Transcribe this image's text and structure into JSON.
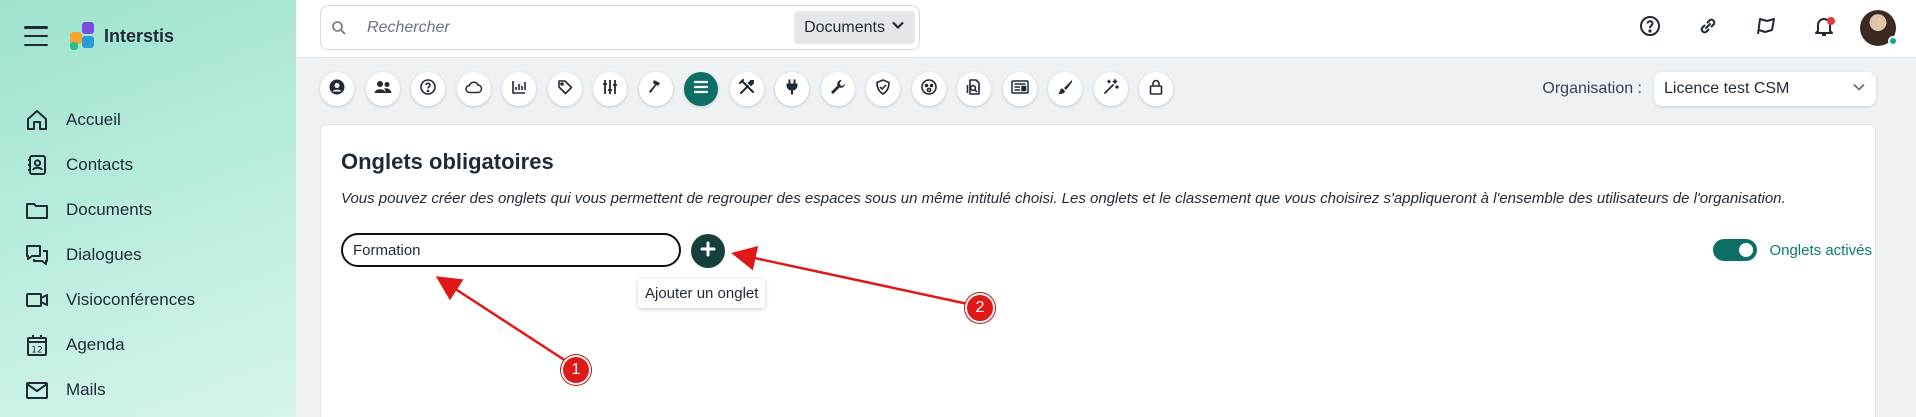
{
  "app": {
    "name": "Interstis"
  },
  "nav": {
    "items": [
      {
        "label": "Accueil",
        "icon": "home-icon"
      },
      {
        "label": "Contacts",
        "icon": "contacts-icon"
      },
      {
        "label": "Documents",
        "icon": "folder-icon"
      },
      {
        "label": "Dialogues",
        "icon": "chat-icon"
      },
      {
        "label": "Visioconférences",
        "icon": "video-icon"
      },
      {
        "label": "Agenda",
        "icon": "calendar-icon"
      },
      {
        "label": "Mails",
        "icon": "mail-icon"
      }
    ],
    "agenda_day": "12"
  },
  "search": {
    "placeholder": "Rechercher",
    "scope": "Documents"
  },
  "topbar": {
    "icons": [
      "help-icon",
      "link-icon",
      "flag-icon",
      "bell-icon",
      "avatar"
    ],
    "notif_color": "#e53935"
  },
  "toolbar": {
    "icons": [
      "user-icon",
      "users-icon",
      "help-icon",
      "cloud-icon",
      "chart-icon",
      "tag-icon",
      "sliders-icon",
      "hammer-icon",
      "list-icon",
      "tools-icon",
      "plug-icon",
      "wrench-icon",
      "shield-check-icon",
      "face-icon",
      "document-search-icon",
      "id-card-icon",
      "brush-icon",
      "magic-wand-icon",
      "lock-icon"
    ],
    "active_index": 8
  },
  "org": {
    "label": "Organisation :",
    "value": "Licence test CSM"
  },
  "card": {
    "title": "Onglets obligatoires",
    "description": "Vous pouvez créer des onglets qui vous permettent de regrouper des espaces sous un même intitulé choisi. Les onglets et le classement que vous choisirez s'appliqueront à l'ensemble des utilisateurs de l'organisation.",
    "input_value": "Formation",
    "add_tooltip": "Ajouter un onglet",
    "toggle_label": "Onglets activés",
    "toggle_on": true
  },
  "annotations": [
    {
      "label": "1"
    },
    {
      "label": "2"
    }
  ],
  "colors": {
    "accent": "#0d6e65",
    "add_button": "#17403d",
    "annotation": "#e01818"
  }
}
